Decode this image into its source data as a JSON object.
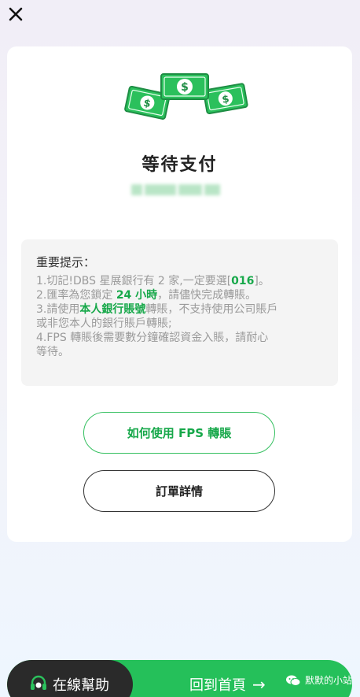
{
  "header": {
    "close_icon": "close-icon"
  },
  "card": {
    "illustration": "money-bills-icon",
    "title": "等待支付",
    "amount": ""
  },
  "notice": {
    "title": "重要提示：",
    "line1_a": "1.切記!DBS 星展銀行有 2 家,一定要選[",
    "line1_code": "016",
    "line1_b": "]。",
    "line2_a": "2.匯率為您鎖定 ",
    "line2_hours": "24 小時",
    "line2_b": "，請儘快完成轉賬。",
    "line3_a": "3.請使用",
    "line3_account": "本人銀行賬號",
    "line3_b": "轉賬，不支持使用公司賬戶",
    "line3_c": "或非您本人的銀行賬戶轉賬;",
    "line4_a": "4.FPS 轉賬後需要數分鐘確認資金入賬，請耐心",
    "line4_b": "等待。"
  },
  "buttons": {
    "fps_label": "如何使用 FPS 轉賬",
    "order_label": "訂單詳情"
  },
  "bottom": {
    "help_label": "在線幫助",
    "home_label": "回到首頁"
  },
  "watermark": {
    "text": "默默的小站"
  },
  "colors": {
    "accent": "#25c05a",
    "dark": "#2a2a2a",
    "highlight": "#17a84a"
  }
}
